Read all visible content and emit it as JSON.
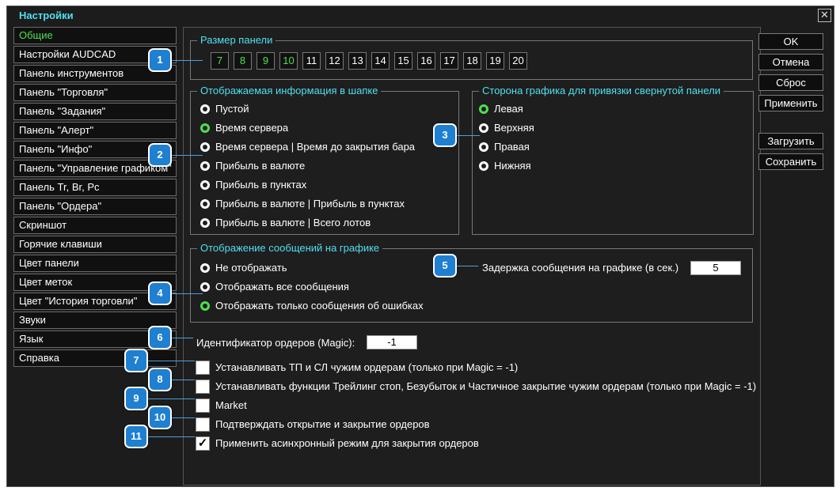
{
  "window": {
    "title": "Настройки",
    "close_symbol": "✕"
  },
  "sidebar": {
    "items": [
      {
        "label": "Общие",
        "active": true
      },
      {
        "label": "Настройки AUDCAD"
      },
      {
        "label": "Панель инструментов"
      },
      {
        "label": "Панель \"Торговля\""
      },
      {
        "label": "Панель \"Задания\""
      },
      {
        "label": "Панель \"Алерт\""
      },
      {
        "label": "Панель \"Инфо\""
      },
      {
        "label": "Панель \"Управление графиком\""
      },
      {
        "label": "Панель Tr, Br, Pc"
      },
      {
        "label": "Панель \"Ордера\""
      },
      {
        "label": "Скриншот"
      },
      {
        "label": "Горячие клавиши"
      },
      {
        "label": "Цвет панели"
      },
      {
        "label": "Цвет меток"
      },
      {
        "label": "Цвет \"История торговли\""
      },
      {
        "label": "Звуки"
      },
      {
        "label": "Язык"
      },
      {
        "label": "Справка"
      }
    ]
  },
  "panel_size": {
    "title": "Размер панели",
    "options": [
      "7",
      "8",
      "9",
      "10",
      "11",
      "12",
      "13",
      "14",
      "15",
      "16",
      "17",
      "18",
      "19",
      "20"
    ]
  },
  "header_info": {
    "title": "Отображаемая информация в шапке",
    "options": [
      "Пустой",
      "Время сервера",
      "Время сервера | Время до закрытия бара",
      "Прибыль в валюте",
      "Прибыль в пунктах",
      "Прибыль в валюте | Прибыль в пунктах",
      "Прибыль в валюте | Всего лотов"
    ],
    "selected": 1
  },
  "collapsed_side": {
    "title": "Сторона графика для привязки свернутой панели",
    "options": [
      "Левая",
      "Верхняя",
      "Правая",
      "Нижняя"
    ],
    "selected": 0
  },
  "messages": {
    "title": "Отображение сообщений на графике",
    "options": [
      "Не отображать",
      "Отображать все сообщения",
      "Отображать только сообщения об ошибках"
    ],
    "selected": 2,
    "delay_label": "Задержка сообщения на графике (в сек.)",
    "delay_value": "5"
  },
  "magic": {
    "label": "Идентификатор ордеров (Magic):",
    "value": "-1"
  },
  "checkboxes": [
    {
      "label": "Устанавливать ТП и СЛ чужим ордерам (только при Magic = -1)",
      "checked": false
    },
    {
      "label": "Устанавливать функции Трейлинг стоп, Безубыток и Частичное закрытие чужим ордерам (только при Magic = -1)",
      "checked": false
    },
    {
      "label": "Market",
      "checked": false
    },
    {
      "label": "Подтверждать открытие и закрытие ордеров",
      "checked": false
    },
    {
      "label": "Применить асинхронный режим для закрытия ордеров",
      "checked": true
    }
  ],
  "check_mark": "✓",
  "buttons": {
    "ok": "OK",
    "cancel": "Отмена",
    "reset": "Сброс",
    "apply": "Применить",
    "load": "Загрузить",
    "save": "Сохранить"
  },
  "badges": [
    "1",
    "2",
    "3",
    "4",
    "5",
    "6",
    "7",
    "8",
    "9",
    "10",
    "11"
  ],
  "colors": {
    "title_cyan": "#4ee0f0",
    "active_green": "#4ee04e",
    "badge_blue": "#1f7fd0",
    "window_bg": "#1c1c1c"
  }
}
